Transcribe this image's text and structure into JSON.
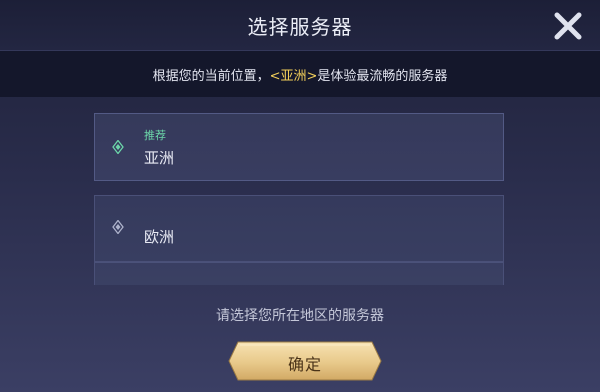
{
  "dialog": {
    "title": "选择服务器",
    "close_icon": "close-icon"
  },
  "info": {
    "prefix": "根据您的当前位置，",
    "highlight": "<亚洲>",
    "suffix": "是体验最流畅的服务器",
    "highlight_color": "#f2cf5a"
  },
  "servers": [
    {
      "tag": "推荐",
      "name": "亚洲",
      "selected": true,
      "icon": "diamond-icon",
      "icon_color": "#6cd6a9"
    },
    {
      "tag": "",
      "name": "欧洲",
      "selected": false,
      "icon": "diamond-icon",
      "icon_color": "#aeb3cb"
    }
  ],
  "hint": "请选择您所在地区的服务器",
  "confirm_label": "确定",
  "colors": {
    "accent_gold": "#e8c98a",
    "recommend_green": "#6cd6a9"
  }
}
